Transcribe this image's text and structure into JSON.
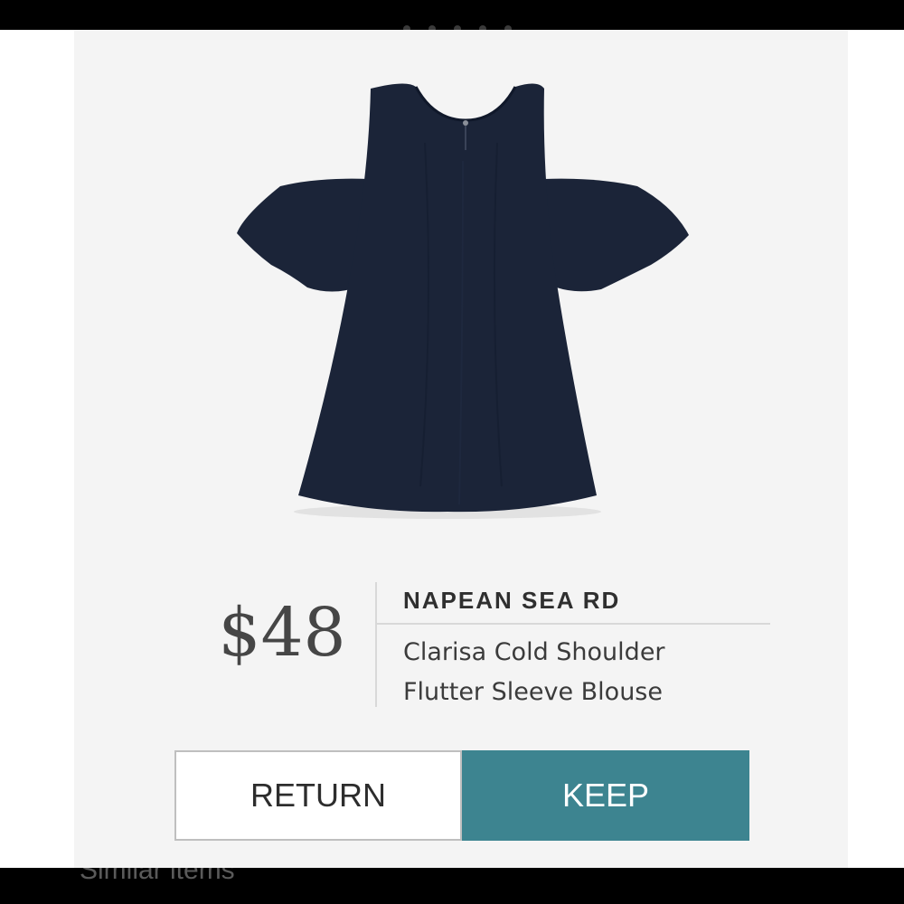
{
  "product": {
    "price": "$48",
    "brand": "NAPEAN SEA RD",
    "name_line1": "Clarisa Cold Shoulder",
    "name_line2": "Flutter Sleeve Blouse",
    "image_icon": "navy-cold-shoulder-blouse-image"
  },
  "actions": {
    "return_label": "RETURN",
    "keep_label": "KEEP"
  },
  "footer": {
    "peek_label": "Similar items"
  },
  "colors": {
    "keep_accent": "#3d8490",
    "garment": "#1b2438",
    "card_background": "#f4f4f4"
  }
}
